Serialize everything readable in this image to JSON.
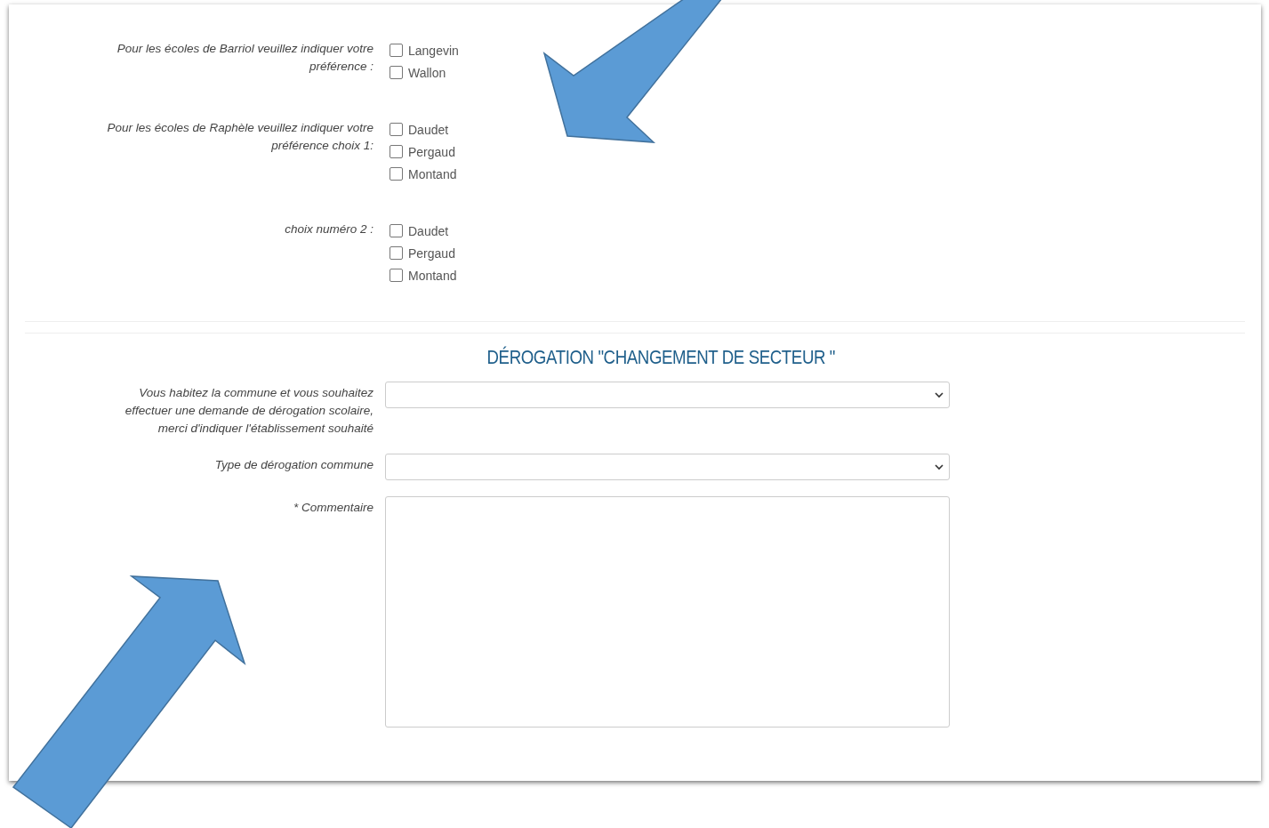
{
  "preference_groups": [
    {
      "label": "Pour les écoles de Barriol veuillez indiquer votre préférence :",
      "options": [
        {
          "label": "Langevin",
          "checked": false
        },
        {
          "label": "Wallon",
          "checked": false
        }
      ]
    },
    {
      "label": "Pour les écoles de Raphèle veuillez indiquer votre préférence choix 1:",
      "options": [
        {
          "label": "Daudet",
          "checked": false
        },
        {
          "label": "Pergaud",
          "checked": false
        },
        {
          "label": "Montand",
          "checked": false
        }
      ]
    },
    {
      "label": "choix numéro 2 :",
      "options": [
        {
          "label": "Daudet",
          "checked": false
        },
        {
          "label": "Pergaud",
          "checked": false
        },
        {
          "label": "Montand",
          "checked": false
        }
      ]
    }
  ],
  "section": {
    "title": "DÉROGATION \"CHANGEMENT DE SECTEUR \"",
    "fields": [
      {
        "kind": "select",
        "label": "Vous habitez la commune et vous souhaitez effectuer une demande de dérogation scolaire, merci d'indiquer l'établissement souhaité"
      },
      {
        "kind": "select",
        "label": "Type de dérogation commune"
      },
      {
        "kind": "textarea",
        "label": "* Commentaire"
      }
    ]
  }
}
